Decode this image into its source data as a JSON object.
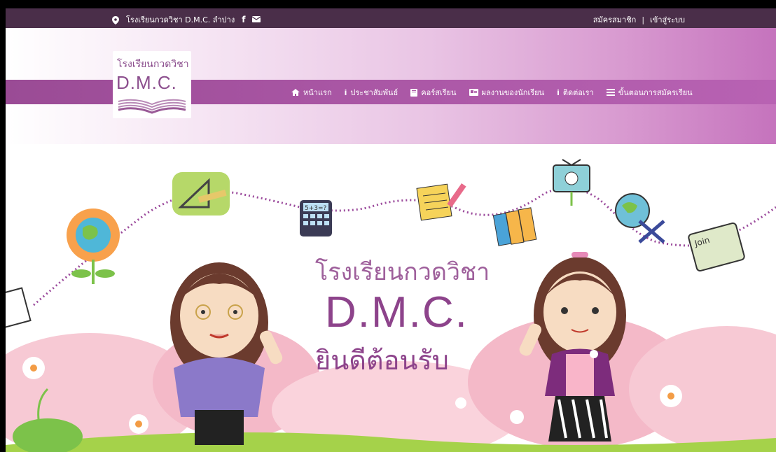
{
  "topbar": {
    "school_location": "โรงเรียนกวดวิชา D.M.C. ลำปาง",
    "facebook_icon": "facebook-icon",
    "mail_icon": "mail-icon",
    "register": "สมัครสมาชิก",
    "separator": "|",
    "login": "เข้าสู่ระบบ"
  },
  "logo": {
    "thai": "โรงเรียนกวดวิชา",
    "dmc": "D.M.C."
  },
  "nav": {
    "items": [
      {
        "label": "หน้าแรก",
        "icon": "home-icon"
      },
      {
        "label": "ประชาสัมพันธ์",
        "icon": "info-icon"
      },
      {
        "label": "คอร์สเรียน",
        "icon": "book-icon"
      },
      {
        "label": "ผลงานของนักเรียน",
        "icon": "card-icon"
      },
      {
        "label": "ติดต่อเรา",
        "icon": "info-icon"
      },
      {
        "label": "ขั้นตอนการสมัครเรียน",
        "icon": "list-icon"
      }
    ]
  },
  "hero": {
    "line1": "โรงเรียนกวดวิชา",
    "line2": "D.M.C.",
    "line3": "ยินดีต้อนรับ",
    "calc_text": "5+3=?",
    "join_text": "Join"
  },
  "colors": {
    "topbar": "#4a2e49",
    "nav": "#a855a3",
    "accent": "#8d438b"
  }
}
